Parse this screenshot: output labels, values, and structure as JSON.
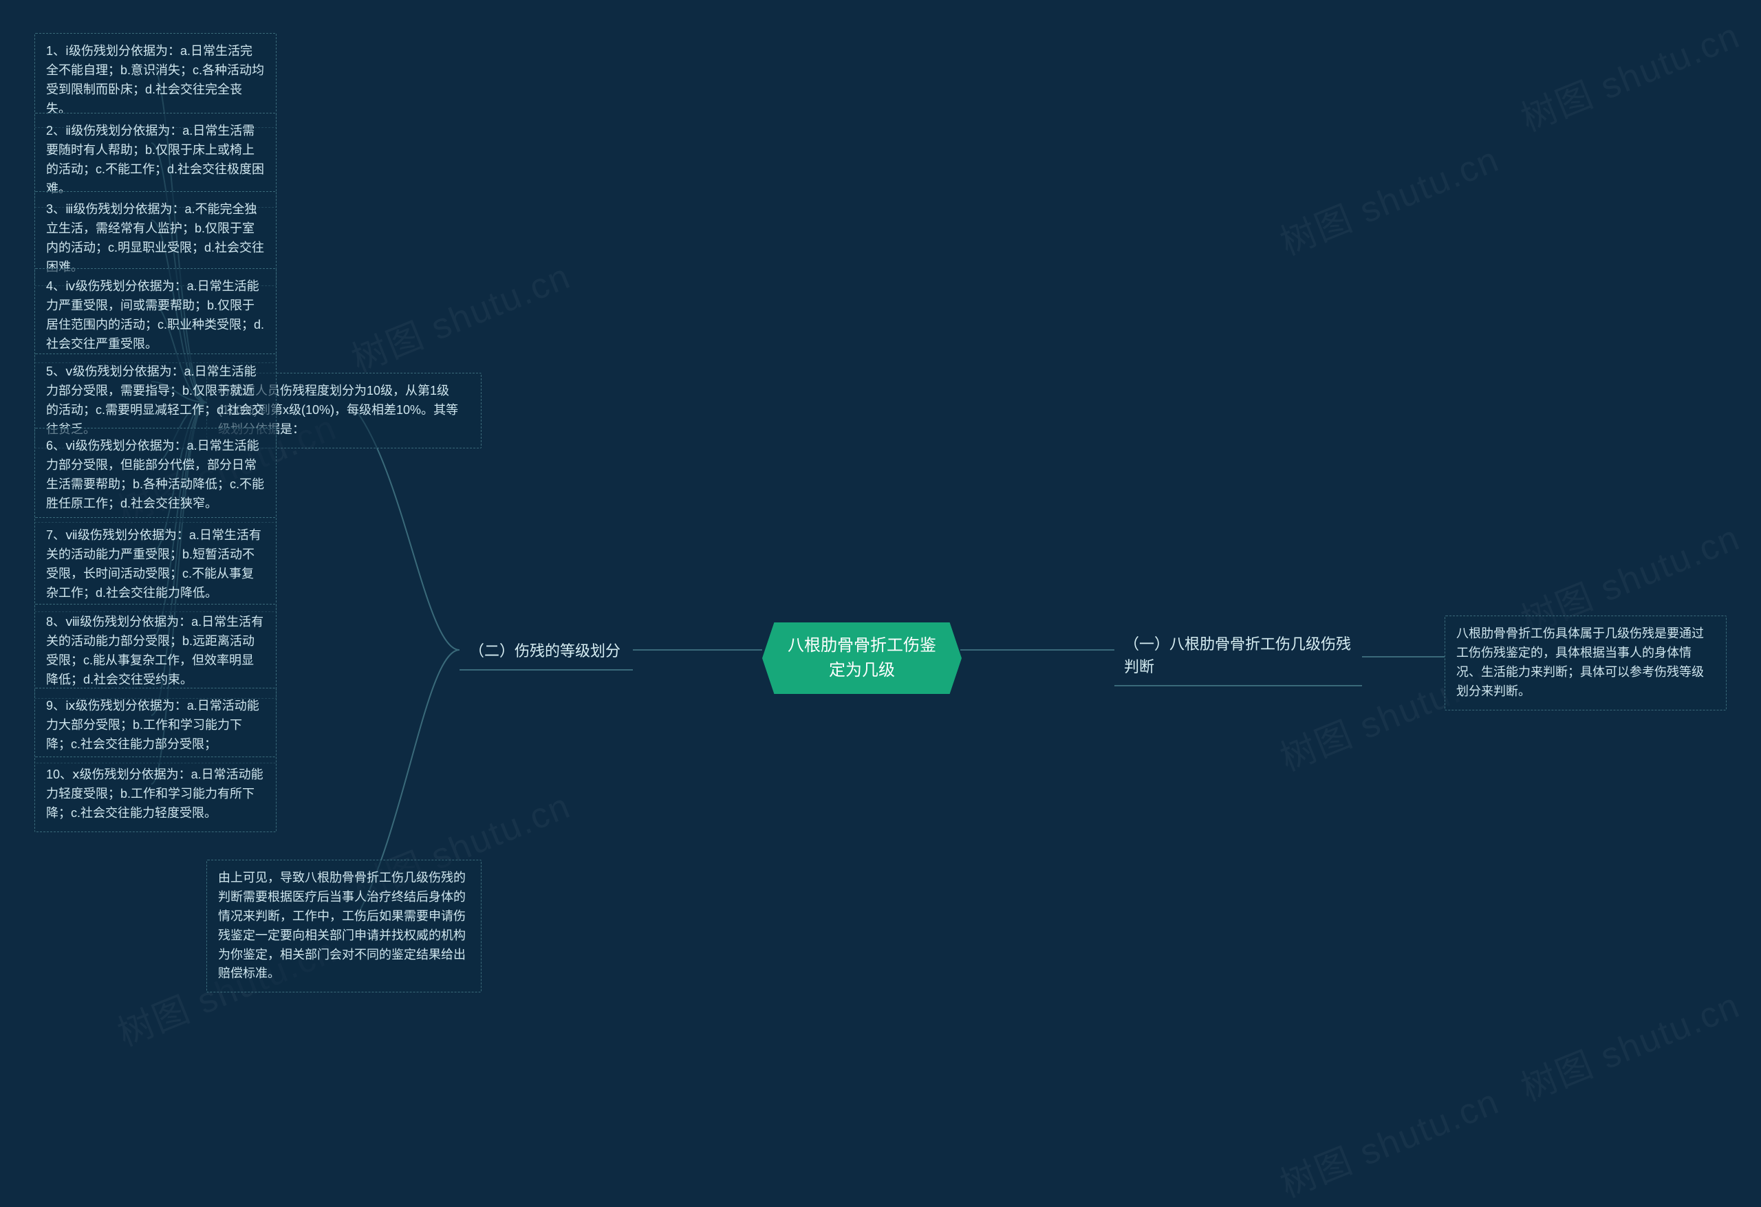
{
  "watermark": "树图 shutu.cn",
  "root": {
    "title": "八根肋骨骨折工伤鉴定为几级"
  },
  "right": {
    "branch1": {
      "label": "（一）八根肋骨骨折工伤几级伤残判断",
      "leaf": "八根肋骨骨折工伤具体属于几级伤残是要通过工伤伤残鉴定的，具体根据当事人的身体情况、生活能力来判断；具体可以参考伤残等级划分来判断。"
    }
  },
  "left": {
    "branch2": {
      "label": "（二）伤残的等级划分",
      "intro": "将受伤人员伤残程度划分为10级，从第1级(100%)到第x级(10%)，每级相差10%。其等级划分依据是：",
      "items": [
        "1、ⅰ级伤残划分依据为：a.日常生活完全不能自理；b.意识消失；c.各种活动均受到限制而卧床；d.社会交往完全丧失。",
        "2、ⅱ级伤残划分依据为：a.日常生活需要随时有人帮助；b.仅限于床上或椅上的活动；c.不能工作；d.社会交往极度困难。",
        "3、ⅲ级伤残划分依据为：a.不能完全独立生活，需经常有人监护；b.仅限于室内的活动；c.明显职业受限；d.社会交往困难。",
        "4、ⅳ级伤残划分依据为：a.日常生活能力严重受限，间或需要帮助；b.仅限于居住范围内的活动；c.职业种类受限；d.社会交往严重受限。",
        "5、ⅴ级伤残划分依据为：a.日常生活能力部分受限，需要指导；b.仅限于就近的活动；c.需要明显减轻工作；d.社会交往贫乏。",
        "6、ⅵ级伤残划分依据为：a.日常生活能力部分受限，但能部分代偿，部分日常生活需要帮助；b.各种活动降低；c.不能胜任原工作；d.社会交往狭窄。",
        "7、ⅶ级伤残划分依据为：a.日常生活有关的活动能力严重受限；b.短暂活动不受限，长时间活动受限；c.不能从事复杂工作；d.社会交往能力降低。",
        "8、ⅷ级伤残划分依据为：a.日常生活有关的活动能力部分受限；b.远距离活动受限；c.能从事复杂工作，但效率明显降低；d.社会交往受约束。",
        "9、ⅸ级伤残划分依据为：a.日常活动能力大部分受限；b.工作和学习能力下降；c.社会交往能力部分受限；",
        "10、ⅹ级伤残划分依据为：a.日常活动能力轻度受限；b.工作和学习能力有所下降；c.社会交往能力轻度受限。"
      ],
      "conclusion": "由上可见，导致八根肋骨骨折工伤几级伤残的判断需要根据医疗后当事人治疗终结后身体的情况来判断，工作中，工伤后如果需要申请伤残鉴定一定要向相关部门申请并找权威的机构为你鉴定，相关部门会对不同的鉴定结果给出赔偿标准。"
    }
  }
}
